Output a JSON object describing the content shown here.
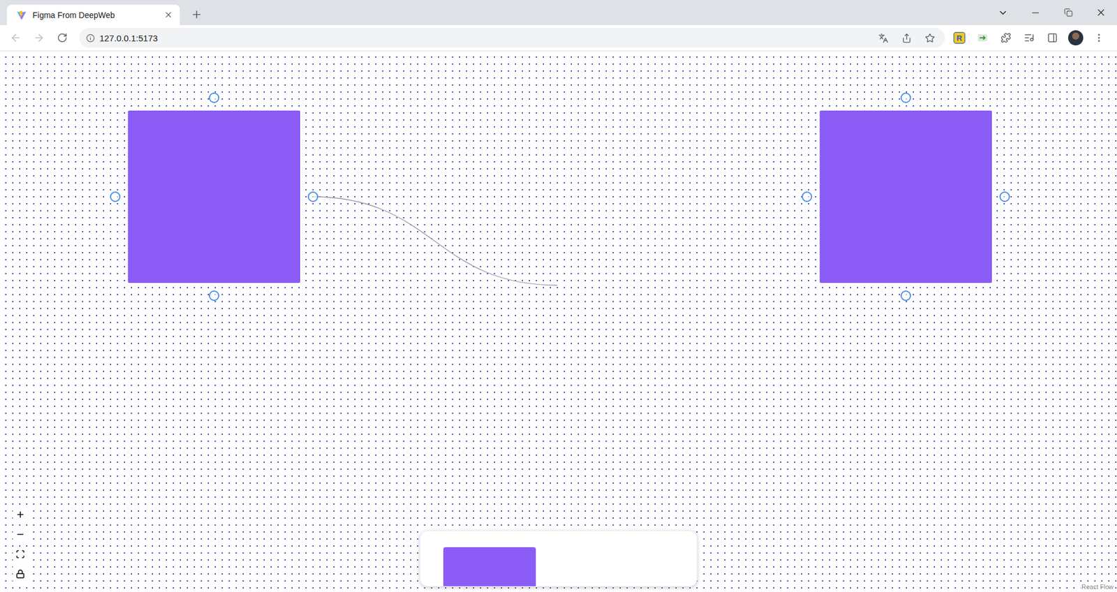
{
  "window": {
    "tabs": [
      {
        "label": "Figma From DeepWeb",
        "selected": true
      }
    ],
    "address": "127.0.0.1:5173",
    "extensions": [
      {
        "label": "R"
      }
    ]
  },
  "canvas": {
    "nodes": [
      {
        "handles": [
          "top",
          "left",
          "right",
          "bottom"
        ]
      },
      {
        "handles": [
          "top",
          "left",
          "right",
          "bottom"
        ]
      }
    ],
    "connection": {
      "from_node": 0,
      "from_handle": "right",
      "connected": false
    }
  },
  "toolbar": {
    "items": [
      {
        "kind": "rectangle"
      }
    ]
  },
  "controls": [
    {
      "kind": "zoom-in"
    },
    {
      "kind": "zoom-out"
    },
    {
      "kind": "fit-view"
    },
    {
      "kind": "lock"
    }
  ],
  "attribution": "React Flow"
}
